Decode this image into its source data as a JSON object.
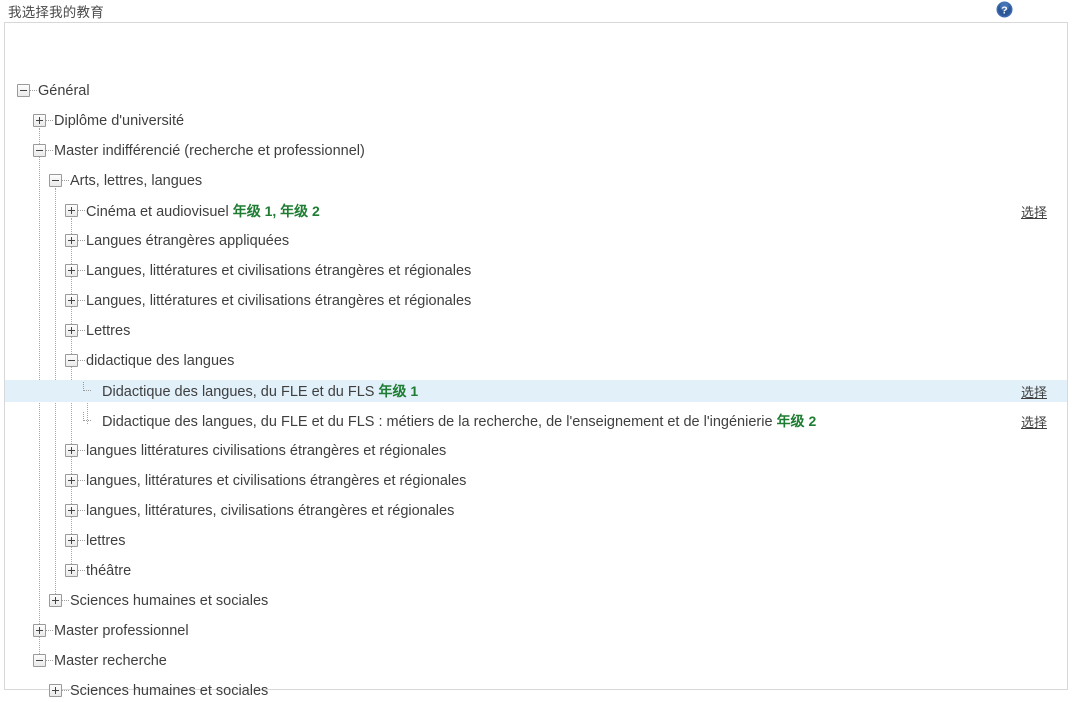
{
  "header": {
    "title": "我选择我的教育",
    "help_icon": "help-circle-icon",
    "help_icon_color": "#2e5fa3"
  },
  "panel": {
    "select_link_label": "选择",
    "highlight_color": "#e2f0fa",
    "grade_color": "#1e7d32",
    "border_color": "#d8d8d8"
  },
  "tree": {
    "nodes": [
      {
        "id": "general",
        "label": "Général",
        "depth": 0,
        "toggle": "minus",
        "expanded": true,
        "grade": "",
        "select": false,
        "selected": false
      },
      {
        "id": "diplome-universite",
        "label": "Diplôme d'université",
        "depth": 1,
        "toggle": "plus",
        "expanded": false,
        "grade": "",
        "select": false,
        "selected": false
      },
      {
        "id": "master-indifferencie",
        "label": "Master indifférencié (recherche et professionnel)",
        "depth": 1,
        "toggle": "minus",
        "expanded": true,
        "grade": "",
        "select": false,
        "selected": false
      },
      {
        "id": "arts-lettres-langues",
        "label": "Arts, lettres, langues",
        "depth": 2,
        "toggle": "minus",
        "expanded": true,
        "grade": "",
        "select": false,
        "selected": false
      },
      {
        "id": "cinema-audiovisuel",
        "label": "Cinéma et audiovisuel",
        "depth": 3,
        "toggle": "plus",
        "expanded": false,
        "grade": "年级 1, 年级 2",
        "select": true,
        "selected": false
      },
      {
        "id": "langues-etrangeres-appliquees",
        "label": "Langues étrangères appliquées",
        "depth": 3,
        "toggle": "plus",
        "expanded": false,
        "grade": "",
        "select": false,
        "selected": false
      },
      {
        "id": "llcer-1",
        "label": "Langues, littératures et civilisations étrangères et régionales",
        "depth": 3,
        "toggle": "plus",
        "expanded": false,
        "grade": "",
        "select": false,
        "selected": false
      },
      {
        "id": "llcer-2",
        "label": "Langues, littératures et civilisations étrangères et régionales",
        "depth": 3,
        "toggle": "plus",
        "expanded": false,
        "grade": "",
        "select": false,
        "selected": false
      },
      {
        "id": "lettres-upper",
        "label": "Lettres",
        "depth": 3,
        "toggle": "plus",
        "expanded": false,
        "grade": "",
        "select": false,
        "selected": false
      },
      {
        "id": "didactique-des-langues",
        "label": "didactique des langues",
        "depth": 3,
        "toggle": "minus",
        "expanded": true,
        "grade": "",
        "select": false,
        "selected": false
      },
      {
        "id": "didactique-fle-fls-1",
        "label": "Didactique des langues, du FLE et du FLS",
        "depth": 4,
        "toggle": "leaf",
        "expanded": false,
        "grade": "年级 1",
        "select": true,
        "selected": true
      },
      {
        "id": "didactique-fle-fls-2",
        "label": "Didactique des langues, du FLE et du FLS : métiers de la recherche, de l'enseignement et de l'ingénierie",
        "depth": 4,
        "toggle": "leaf",
        "expanded": false,
        "grade": "年级 2",
        "select": true,
        "selected": false
      },
      {
        "id": "llcer-lower-1",
        "label": "langues littératures civilisations étrangères et régionales",
        "depth": 3,
        "toggle": "plus",
        "expanded": false,
        "grade": "",
        "select": false,
        "selected": false
      },
      {
        "id": "llcer-lower-2",
        "label": "langues, littératures et civilisations étrangères et régionales",
        "depth": 3,
        "toggle": "plus",
        "expanded": false,
        "grade": "",
        "select": false,
        "selected": false
      },
      {
        "id": "llcer-lower-3",
        "label": "langues, littératures, civilisations étrangères et régionales",
        "depth": 3,
        "toggle": "plus",
        "expanded": false,
        "grade": "",
        "select": false,
        "selected": false
      },
      {
        "id": "lettres-lower",
        "label": "lettres",
        "depth": 3,
        "toggle": "plus",
        "expanded": false,
        "grade": "",
        "select": false,
        "selected": false
      },
      {
        "id": "theatre",
        "label": "théâtre",
        "depth": 3,
        "toggle": "plus",
        "expanded": false,
        "grade": "",
        "select": false,
        "selected": false
      },
      {
        "id": "sciences-humaines-1",
        "label": "Sciences humaines et sociales",
        "depth": 2,
        "toggle": "plus",
        "expanded": false,
        "grade": "",
        "select": false,
        "selected": false
      },
      {
        "id": "master-professionnel",
        "label": "Master professionnel",
        "depth": 1,
        "toggle": "plus",
        "expanded": false,
        "grade": "",
        "select": false,
        "selected": false
      },
      {
        "id": "master-recherche",
        "label": "Master recherche",
        "depth": 1,
        "toggle": "minus",
        "expanded": true,
        "grade": "",
        "select": false,
        "selected": false
      },
      {
        "id": "sciences-humaines-2",
        "label": "Sciences humaines et sociales",
        "depth": 2,
        "toggle": "plus",
        "expanded": false,
        "grade": "",
        "select": false,
        "selected": false
      }
    ]
  }
}
